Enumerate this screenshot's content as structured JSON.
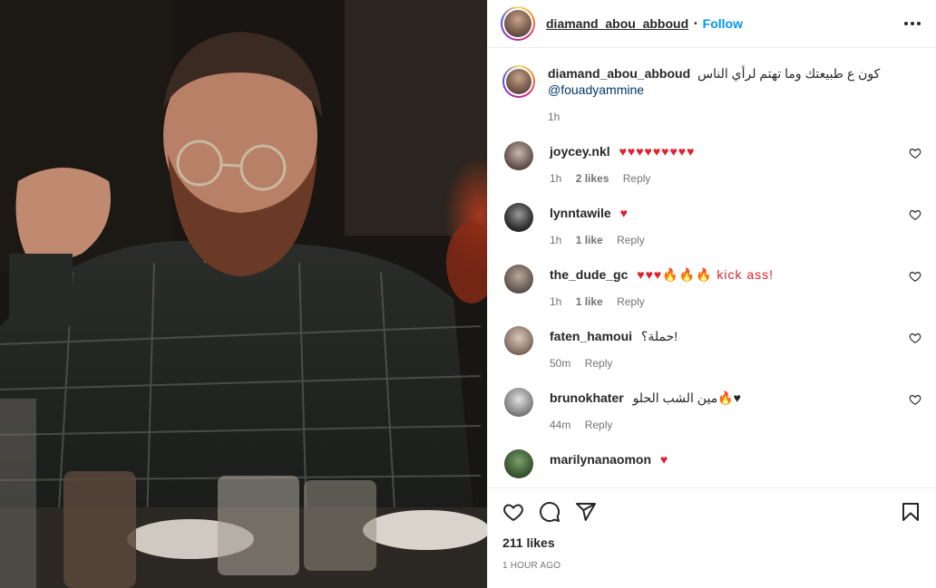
{
  "post": {
    "author": "diamand_abou_abboud",
    "follow_label": "Follow",
    "separator": "•",
    "caption_text": "كون ع طبيعتك وما تهتم لرأي الناس",
    "caption_mention": "@fouadyammine",
    "caption_time": "1h"
  },
  "comments": [
    {
      "user": "joycey.nkl",
      "text": "♥♥♥♥♥♥♥♥♥",
      "time": "1h",
      "likes": "2 likes",
      "reply": "Reply"
    },
    {
      "user": "lynntawile",
      "text": "♥",
      "time": "1h",
      "likes": "1 like",
      "reply": "Reply"
    },
    {
      "user": "the_dude_gc",
      "text": "♥♥♥🔥🔥🔥 kick ass!",
      "time": "1h",
      "likes": "1 like",
      "reply": "Reply"
    },
    {
      "user": "faten_hamoui",
      "text": "حملة؟!",
      "time": "50m",
      "likes": "",
      "reply": "Reply"
    },
    {
      "user": "brunokhater",
      "text": "مين الشب الحلو🔥♥",
      "time": "44m",
      "likes": "",
      "reply": "Reply"
    },
    {
      "user": "marilynanaomon",
      "text": "♥",
      "time": "",
      "likes": "",
      "reply": ""
    }
  ],
  "footer": {
    "likes": "211 likes",
    "time_ago": "1 HOUR AGO"
  },
  "icons": {
    "like": "heart-icon",
    "comment": "comment-icon",
    "share": "share-icon",
    "save": "bookmark-icon",
    "more": "more-options-icon"
  },
  "colors": {
    "accent": "#0095f6",
    "heart": "#e0202e",
    "muted": "#737373",
    "mention": "#00376b"
  }
}
